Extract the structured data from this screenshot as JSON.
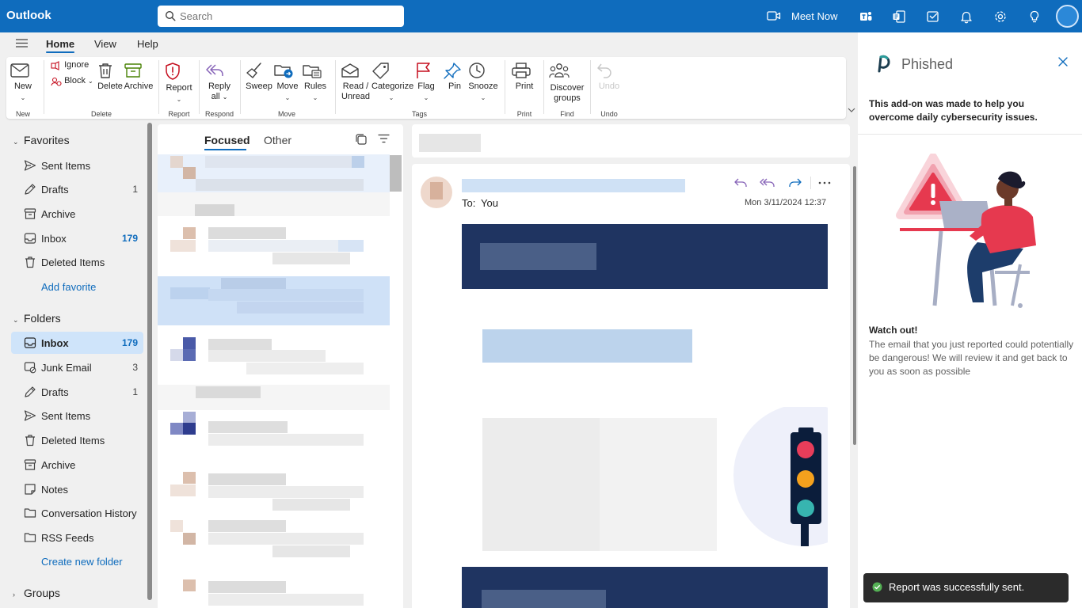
{
  "app": {
    "title": "Outlook"
  },
  "search": {
    "placeholder": "Search"
  },
  "topbar": {
    "meet_now": "Meet Now"
  },
  "tabs": [
    {
      "label": "Home"
    },
    {
      "label": "View"
    },
    {
      "label": "Help"
    }
  ],
  "ribbon": {
    "new": "New",
    "ignore": "Ignore",
    "block": "Block",
    "delete": "Delete",
    "archive": "Archive",
    "report": "Report",
    "reply_all_1": "Reply",
    "reply_all_2": "all",
    "sweep": "Sweep",
    "move": "Move",
    "rules": "Rules",
    "read_unread_1": "Read /",
    "read_unread_2": "Unread",
    "categorize": "Categorize",
    "flag": "Flag",
    "pin": "Pin",
    "snooze": "Snooze",
    "print": "Print",
    "discover_groups_1": "Discover",
    "discover_groups_2": "groups",
    "undo": "Undo",
    "groups": {
      "new": "New",
      "delete": "Delete",
      "report": "Report",
      "respond": "Respond",
      "move": "Move",
      "tags": "Tags",
      "print": "Print",
      "find": "Find",
      "undo": "Undo"
    }
  },
  "nav": {
    "favorites_header": "Favorites",
    "favorites": [
      {
        "label": "Sent Items",
        "count": ""
      },
      {
        "label": "Drafts",
        "count": "1"
      },
      {
        "label": "Archive",
        "count": ""
      },
      {
        "label": "Inbox",
        "count": "179"
      },
      {
        "label": "Deleted Items",
        "count": ""
      }
    ],
    "add_favorite": "Add favorite",
    "folders_header": "Folders",
    "folders": [
      {
        "label": "Inbox",
        "count": "179"
      },
      {
        "label": "Junk Email",
        "count": "3"
      },
      {
        "label": "Drafts",
        "count": "1"
      },
      {
        "label": "Sent Items",
        "count": ""
      },
      {
        "label": "Deleted Items",
        "count": ""
      },
      {
        "label": "Archive",
        "count": ""
      },
      {
        "label": "Notes",
        "count": ""
      },
      {
        "label": "Conversation History",
        "count": ""
      },
      {
        "label": "RSS Feeds",
        "count": ""
      }
    ],
    "create_folder": "Create new folder",
    "groups_header": "Groups"
  },
  "list": {
    "focused": "Focused",
    "other": "Other"
  },
  "reading": {
    "to_label": "To:",
    "to_value": "You",
    "date": "Mon 3/11/2024 12:37"
  },
  "addin": {
    "name": "Phished",
    "intro": "This add-on was made to help you overcome daily cybersecurity issues.",
    "watch_title": "Watch out!",
    "watch_text": "The email that you just reported could potentially be dangerous! We will review it and get back to you as soon as possible"
  },
  "toast": {
    "text": "Report was successfully sent."
  },
  "colors": {
    "accent": "#0f6cbd",
    "selected": "#cfe4fa",
    "report_red": "#c50f1f",
    "reply_purple": "#8764b8",
    "brand_teal": "#2a9d9b"
  }
}
